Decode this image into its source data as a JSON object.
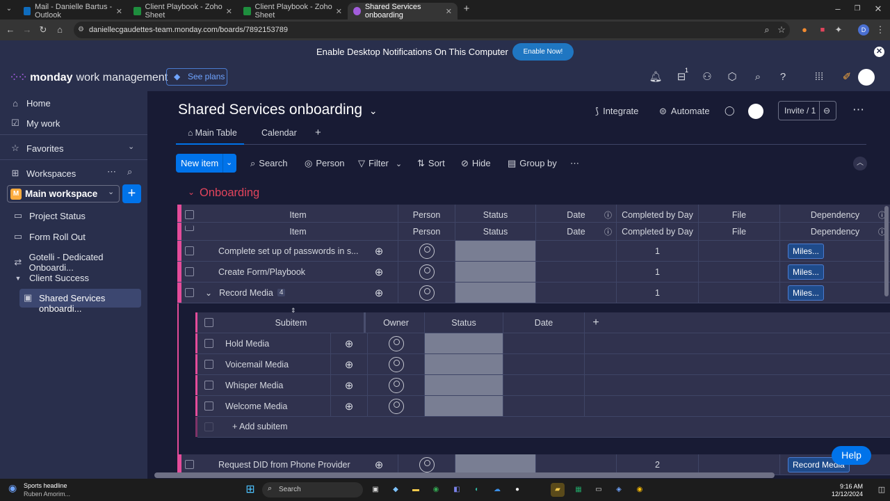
{
  "browser": {
    "tabs": [
      {
        "title": "Mail - Danielle Bartus - Outlook",
        "active": false,
        "color": "#0f6cbd"
      },
      {
        "title": "Client Playbook - Zoho Sheet",
        "active": false,
        "color": "#1e8e3e"
      },
      {
        "title": "Client Playbook - Zoho Sheet",
        "active": false,
        "color": "#1e8e3e"
      },
      {
        "title": "Shared Services onboarding",
        "active": true,
        "color": "#a25ddc"
      }
    ],
    "url": "daniellecgaudettes-team.monday.com/boards/7892153789",
    "profile_initial": "D"
  },
  "notification": {
    "text": "Enable Desktop Notifications On This Computer",
    "button": "Enable Now!"
  },
  "app": {
    "brand": "monday",
    "product": "work management",
    "see_plans": "See plans",
    "inbox_badge": "1"
  },
  "sidebar": {
    "home": "Home",
    "my_work": "My work",
    "favorites": "Favorites",
    "workspaces": "Workspaces",
    "workspace_name": "Main workspace",
    "workspace_badge": "M",
    "items": [
      {
        "label": "Project Status"
      },
      {
        "label": "Form Roll Out"
      },
      {
        "label": "Gotelli - Dedicated Onboardi..."
      }
    ],
    "folder": "Client Success",
    "active_board": "Shared Services onboardi..."
  },
  "board": {
    "title": "Shared Services onboarding",
    "integrate": "Integrate",
    "automate": "Automate",
    "invite": "Invite / 1",
    "tabs": [
      "Main Table",
      "Calendar"
    ],
    "toolbar": {
      "new_item": "New item",
      "search": "Search",
      "person": "Person",
      "filter": "Filter",
      "sort": "Sort",
      "hide": "Hide",
      "group_by": "Group by"
    },
    "group": {
      "name": "Onboarding",
      "color": "#e2445c",
      "columns": [
        "Item",
        "Person",
        "Status",
        "Date",
        "Completed by Day",
        "File",
        "Dependency"
      ],
      "rows": [
        {
          "item": "Complete set up of passwords in s...",
          "completed": "1",
          "dependency": "Miles..."
        },
        {
          "item": "Create Form/Playbook",
          "completed": "1",
          "dependency": "Miles..."
        },
        {
          "item": "Record Media",
          "subitem_count": "4",
          "completed": "1",
          "dependency": "Miles..."
        }
      ],
      "subitems": {
        "columns": [
          "Subitem",
          "Owner",
          "Status",
          "Date"
        ],
        "rows": [
          {
            "name": "Hold Media"
          },
          {
            "name": "Voicemail Media"
          },
          {
            "name": "Whisper Media"
          },
          {
            "name": "Welcome Media"
          }
        ],
        "add_label": "+ Add subitem"
      },
      "last_row": {
        "item": "Request DID from Phone Provider",
        "completed": "2",
        "dependency": "Record Media"
      }
    }
  },
  "help": "Help",
  "taskbar": {
    "news_title": "Sports headline",
    "news_sub": "Ruben Amorim...",
    "search": "Search",
    "time": "9:16 AM",
    "date": "12/12/2024"
  }
}
